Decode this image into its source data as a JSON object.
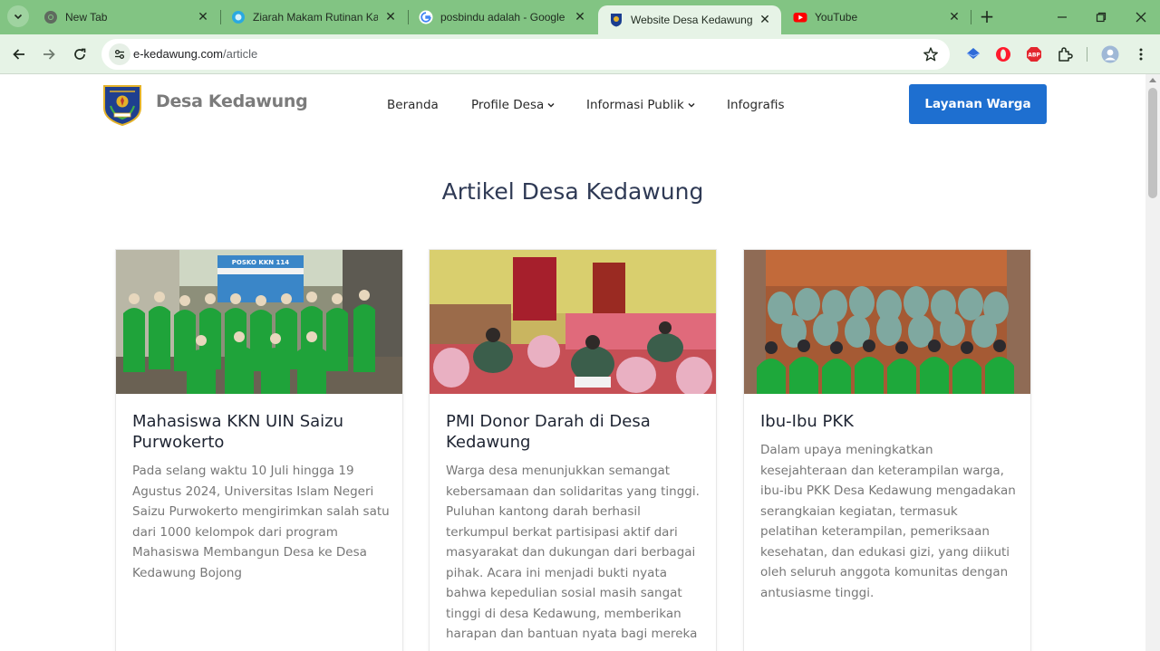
{
  "browser": {
    "tabs": [
      {
        "title": "New Tab",
        "favicon": "chrome-icon",
        "active": false
      },
      {
        "title": "Ziarah Makam Rutinan Kamis",
        "favicon": "globe-icon",
        "active": false
      },
      {
        "title": "posbindu adalah - Google Search",
        "favicon": "google-icon",
        "active": false
      },
      {
        "title": "Website Desa Kedawung",
        "favicon": "village-logo-icon",
        "active": true
      },
      {
        "title": "YouTube",
        "favicon": "youtube-icon",
        "active": false
      }
    ],
    "url_host": "e-kedawung.com",
    "url_path": "/article",
    "colors": {
      "tabstrip": "#82c483",
      "toolbar": "#e6f3e6"
    }
  },
  "site": {
    "brand_name": "Desa Kedawung",
    "nav": {
      "home": "Beranda",
      "profile": "Profile Desa",
      "public_info": "Informasi Publik",
      "infographics": "Infografis"
    },
    "cta_label": "Layanan Warga",
    "accent_color": "#1e6fd0"
  },
  "section_title": "Artikel Desa Kedawung",
  "articles": [
    {
      "title": "Mahasiswa KKN UIN Saizu Purwokerto",
      "image_caption": "POSKO KKN 114",
      "excerpt": "Pada selang waktu 10 Juli hingga 19 Agustus 2024, Universitas Islam Negeri Saizu Purwokerto mengirimkan salah satu dari 1000 kelompok dari program Mahasiswa Membangun Desa ke Desa Kedawung Bojong"
    },
    {
      "title": "PMI Donor Darah di Desa Kedawung",
      "excerpt": "Warga desa menunjukkan semangat kebersamaan dan solidaritas yang tinggi. Puluhan kantong darah berhasil terkumpul berkat partisipasi aktif dari masyarakat dan dukungan dari berbagai pihak. Acara ini menjadi bukti nyata bahwa kepedulian sosial masih sangat tinggi di desa Kedawung, memberikan harapan dan bantuan nyata bagi mereka"
    },
    {
      "title": "Ibu-Ibu PKK",
      "excerpt": "Dalam upaya meningkatkan kesejahteraan dan keterampilan warga, ibu-ibu PKK Desa Kedawung mengadakan serangkaian kegiatan, termasuk pelatihan keterampilan, pemeriksaan kesehatan, dan edukasi gizi, yang diikuti oleh seluruh anggota komunitas dengan antusiasme tinggi."
    }
  ]
}
